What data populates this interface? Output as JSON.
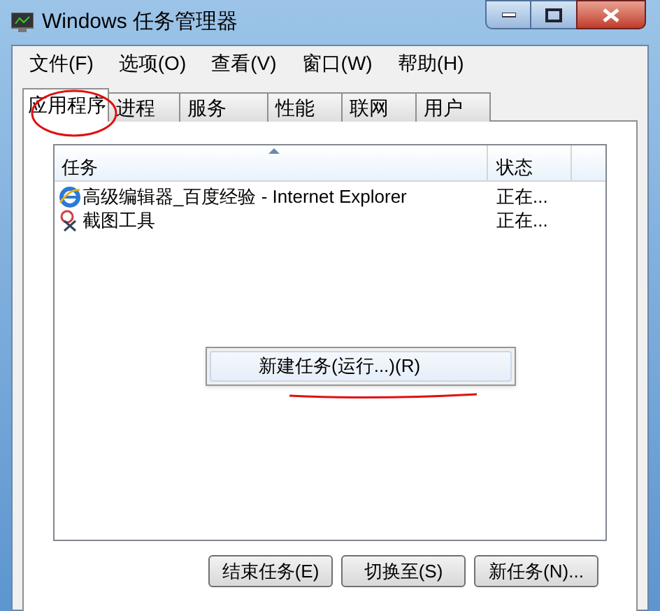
{
  "window": {
    "title": "Windows 任务管理器"
  },
  "menu": [
    "文件(F)",
    "选项(O)",
    "查看(V)",
    "窗口(W)",
    "帮助(H)"
  ],
  "tabs": [
    {
      "label": "应用程序",
      "selected": true
    },
    {
      "label": "进程",
      "selected": false
    },
    {
      "label": "服务",
      "selected": false
    },
    {
      "label": "性能",
      "selected": false
    },
    {
      "label": "联网",
      "selected": false
    },
    {
      "label": "用户",
      "selected": false
    }
  ],
  "table": {
    "columns": [
      "任务",
      "状态"
    ],
    "rows": [
      {
        "kind": "browser",
        "task": "高级编辑器_百度经验 - Internet Explorer",
        "status": "正在..."
      },
      {
        "kind": "snipping",
        "task": "截图工具",
        "status": "正在..."
      }
    ]
  },
  "context_menu": {
    "items": [
      "新建任务(运行...)(R)"
    ]
  },
  "buttons": [
    "结束任务(E)",
    "切换至(S)",
    "新任务(N)..."
  ]
}
